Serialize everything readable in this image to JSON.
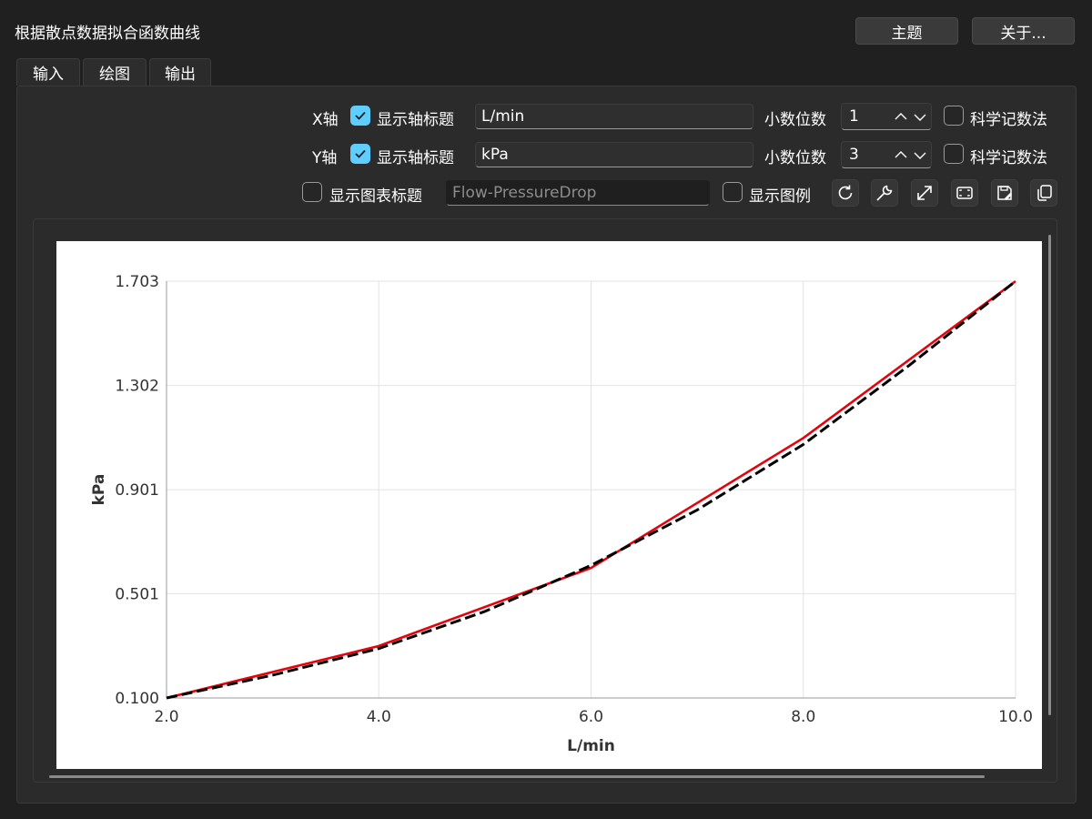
{
  "window": {
    "title": "根据散点数据拟合函数曲线"
  },
  "header": {
    "theme_btn": "主题",
    "about_btn": "关于..."
  },
  "tabs": [
    {
      "label": "输入"
    },
    {
      "label": "绘图"
    },
    {
      "label": "输出"
    }
  ],
  "active_tab": "绘图",
  "x_axis": {
    "label": "X轴",
    "show_title_label": "显示轴标题",
    "show_title_checked": true,
    "title_value": "L/min",
    "decimals_label": "小数位数",
    "decimals_value": "1",
    "sci_label": "科学记数法",
    "sci_checked": false
  },
  "y_axis": {
    "label": "Y轴",
    "show_title_label": "显示轴标题",
    "show_title_checked": true,
    "title_value": "kPa",
    "decimals_label": "小数位数",
    "decimals_value": "3",
    "sci_label": "科学记数法",
    "sci_checked": false
  },
  "chart_options": {
    "show_chart_title_label": "显示图表标题",
    "show_chart_title_checked": false,
    "chart_title_value": "Flow-PressureDrop",
    "show_legend_label": "显示图例",
    "show_legend_checked": false
  },
  "toolbar_icons": [
    "refresh-icon",
    "wrench-icon",
    "expand-icon",
    "fit-icon",
    "save-icon",
    "copy-icon"
  ],
  "chart_data": {
    "type": "line",
    "title": "",
    "xlabel": "L/min",
    "ylabel": "kPa",
    "xlim": [
      2.0,
      10.0
    ],
    "ylim": [
      0.1,
      1.703
    ],
    "x_ticks": [
      "2.0",
      "4.0",
      "6.0",
      "8.0",
      "10.0"
    ],
    "y_ticks": [
      "0.100",
      "0.501",
      "0.901",
      "1.302",
      "1.703"
    ],
    "grid": true,
    "legend": false,
    "series": [
      {
        "color": "#e8000b",
        "style": "solid",
        "x": [
          2.0,
          4.0,
          6.0,
          8.0,
          10.0
        ],
        "y": [
          0.1,
          0.3,
          0.6,
          1.1,
          1.703
        ]
      },
      {
        "color": "#000000",
        "style": "dashed",
        "x": [
          2.0,
          3.0,
          4.0,
          5.0,
          6.0,
          7.0,
          8.0,
          9.0,
          10.0
        ],
        "y": [
          0.1,
          0.188,
          0.29,
          0.433,
          0.61,
          0.823,
          1.075,
          1.38,
          1.703
        ]
      }
    ]
  }
}
